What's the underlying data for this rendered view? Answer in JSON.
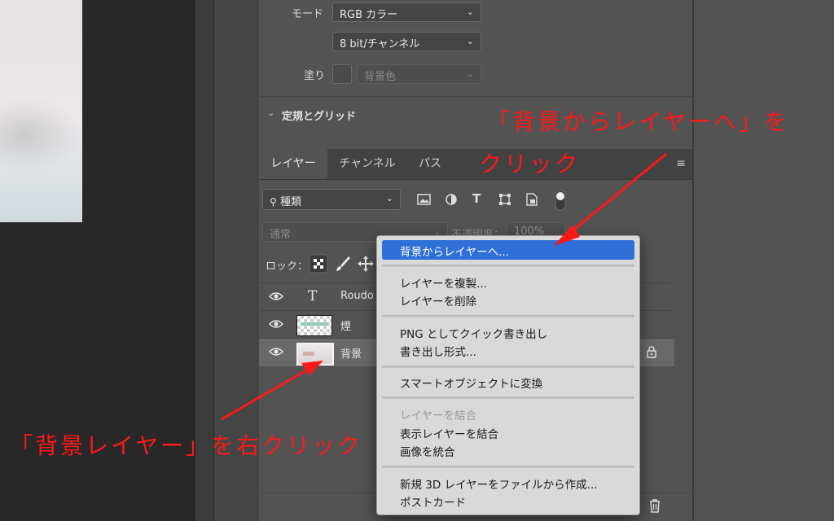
{
  "properties": {
    "mode_label": "モード",
    "mode_value": "RGB カラー",
    "bit_value": "8 bit/チャンネル",
    "fill_label": "塗り",
    "fill_value": "背景色",
    "ruler_section": "定規とグリッド"
  },
  "layers_panel": {
    "tabs": [
      "レイヤー",
      "チャンネル",
      "パス"
    ],
    "filter_label": "種類",
    "blend_mode": "通常",
    "opacity_label": "不透明度：",
    "opacity_value": "100%",
    "lock_label": "ロック：",
    "layers": [
      {
        "name": "Roudo",
        "type": "text"
      },
      {
        "name": "煙",
        "type": "raster"
      },
      {
        "name": "背景",
        "type": "background"
      }
    ]
  },
  "context_menu": {
    "groups": [
      [
        {
          "label": "背景からレイヤーへ...",
          "highlighted": true
        }
      ],
      [
        {
          "label": "レイヤーを複製..."
        },
        {
          "label": "レイヤーを削除"
        }
      ],
      [
        {
          "label": "PNG としてクイック書き出し"
        },
        {
          "label": "書き出し形式..."
        }
      ],
      [
        {
          "label": "スマートオブジェクトに変換"
        }
      ],
      [
        {
          "label": "レイヤーを結合",
          "disabled": true
        },
        {
          "label": "表示レイヤーを結合"
        },
        {
          "label": "画像を統合"
        }
      ],
      [
        {
          "label": "新規 3D レイヤーをファイルから作成..."
        },
        {
          "label": "ポストカード"
        }
      ]
    ]
  },
  "annotations": {
    "top_line1": "「背景からレイヤーへ」を",
    "top_line2": "クリック",
    "bottom": "「背景レイヤー」を右クリック",
    "color": "#ff1818"
  },
  "colors": {
    "panel": "#535353",
    "canvas_bg": "#282828",
    "menu_highlight": "#2f6fd8"
  }
}
